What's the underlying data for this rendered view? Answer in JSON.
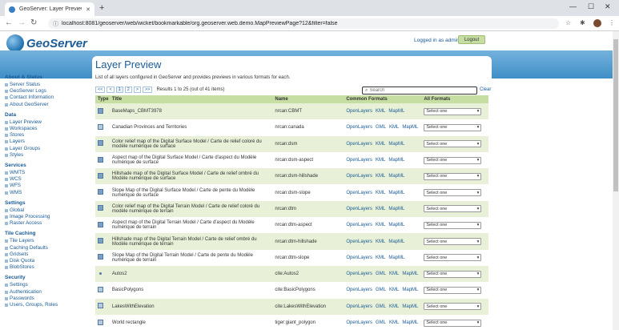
{
  "browser": {
    "tab_title": "GeoServer: Layer Preview",
    "url": "localhost:8081/geoserver/web/wicket/bookmarkable/org.geoserver.web.demo.MapPreviewPage?12&filter=false"
  },
  "header": {
    "logo_text": "GeoServer",
    "logged_in": "Logged in as admin.",
    "logout_label": "Logout"
  },
  "sidebar": {
    "sections": [
      {
        "title": "About & Status",
        "items": [
          "Server Status",
          "GeoServer Logs",
          "Contact Information",
          "About GeoServer"
        ]
      },
      {
        "title": "Data",
        "items": [
          "Layer Preview",
          "Workspaces",
          "Stores",
          "Layers",
          "Layer Groups",
          "Styles"
        ]
      },
      {
        "title": "Services",
        "items": [
          "WMTS",
          "WCS",
          "WFS",
          "WMS"
        ]
      },
      {
        "title": "Settings",
        "items": [
          "Global",
          "Image Processing",
          "Raster Access"
        ]
      },
      {
        "title": "Tile Caching",
        "items": [
          "Tile Layers",
          "Caching Defaults",
          "Gridsets",
          "Disk Quota",
          "BlobStores"
        ]
      },
      {
        "title": "Security",
        "items": [
          "Settings",
          "Authentication",
          "Passwords",
          "Users, Groups, Roles"
        ]
      }
    ]
  },
  "main": {
    "title": "Layer Preview",
    "description": "List of all layers configured in GeoServer and provides previews in various formats for each.",
    "pager": {
      "buttons": [
        "<<",
        "<",
        "1",
        "2",
        ">",
        ">>"
      ],
      "summary": "Results 1 to 25 (out of 41 items)"
    },
    "search_placeholder": "Search",
    "clear_label": "Clear",
    "columns": [
      "Type",
      "Title",
      "Name",
      "Common Formats",
      "All Formats"
    ],
    "select_default": "Select one",
    "rows": [
      {
        "type": "raster",
        "title": "BaseMaps_CBMT3978",
        "name": "nrcan:CBMT",
        "formats": [
          "OpenLayers",
          "KML",
          "MapML"
        ]
      },
      {
        "type": "vector",
        "title": "Canadian Provinces and Territories",
        "name": "nrcan:canada",
        "formats": [
          "OpenLayers",
          "GML",
          "KML",
          "MapML"
        ]
      },
      {
        "type": "raster",
        "title": "Color relief map of the Digital Surface Model / Carte de relief coloré du modèle numérique de surface",
        "name": "nrcan:dsm",
        "formats": [
          "OpenLayers",
          "KML",
          "MapML"
        ]
      },
      {
        "type": "raster",
        "title": "Aspect map of the Digital Surface Model / Carte d'aspect du Modèle numérique de surface",
        "name": "nrcan:dsm-aspect",
        "formats": [
          "OpenLayers",
          "KML",
          "MapML"
        ]
      },
      {
        "type": "raster",
        "title": "Hillshade map of the Digital Surface Model / Carte de relief ombré du Modèle numérique de surface",
        "name": "nrcan:dsm-hillshade",
        "formats": [
          "OpenLayers",
          "KML",
          "MapML"
        ]
      },
      {
        "type": "raster",
        "title": "Slope Map of the Digital Surface Model / Carte de pente du Modèle numérique de surface",
        "name": "nrcan:dsm-slope",
        "formats": [
          "OpenLayers",
          "KML",
          "MapML"
        ]
      },
      {
        "type": "raster",
        "title": "Color relief map of the Digital Terrain Model / Carte de relief coloré du modèle numérique de terrain",
        "name": "nrcan:dtm",
        "formats": [
          "OpenLayers",
          "KML",
          "MapML"
        ]
      },
      {
        "type": "raster",
        "title": "Aspect map of the Digital Terrain Model / Carte d'aspect du Modèle numérique de terrain",
        "name": "nrcan:dtm-aspect",
        "formats": [
          "OpenLayers",
          "KML",
          "MapML"
        ]
      },
      {
        "type": "raster",
        "title": "Hillshade map of the Digital Terrain Model / Carte de relief ombré du Modèle numérique de terrain",
        "name": "nrcan:dtm-hillshade",
        "formats": [
          "OpenLayers",
          "KML",
          "MapML"
        ]
      },
      {
        "type": "raster",
        "title": "Slope Map of the Digital Terrain Model / Carte de pente du Modèle numérique de terrain",
        "name": "nrcan:dtm-slope",
        "formats": [
          "OpenLayers",
          "KML",
          "MapML"
        ]
      },
      {
        "type": "point",
        "title": "Autos2",
        "name": "cite:Autos2",
        "formats": [
          "OpenLayers",
          "GML",
          "KML",
          "MapML"
        ]
      },
      {
        "type": "vector",
        "title": "BasicPolygons",
        "name": "cite:BasicPolygons",
        "formats": [
          "OpenLayers",
          "GML",
          "KML",
          "MapML"
        ]
      },
      {
        "type": "vector",
        "title": "LakesWithElevation",
        "name": "cite:LakesWithElevation",
        "formats": [
          "OpenLayers",
          "GML",
          "KML",
          "MapML"
        ]
      },
      {
        "type": "vector",
        "title": "World rectangle",
        "name": "tiger:giant_polygon",
        "formats": [
          "OpenLayers",
          "GML",
          "KML",
          "MapML"
        ]
      }
    ]
  },
  "colors": {
    "brand": "#1a5b96",
    "header_green": "#c6dea2",
    "row_alt": "#e8f1d8"
  }
}
